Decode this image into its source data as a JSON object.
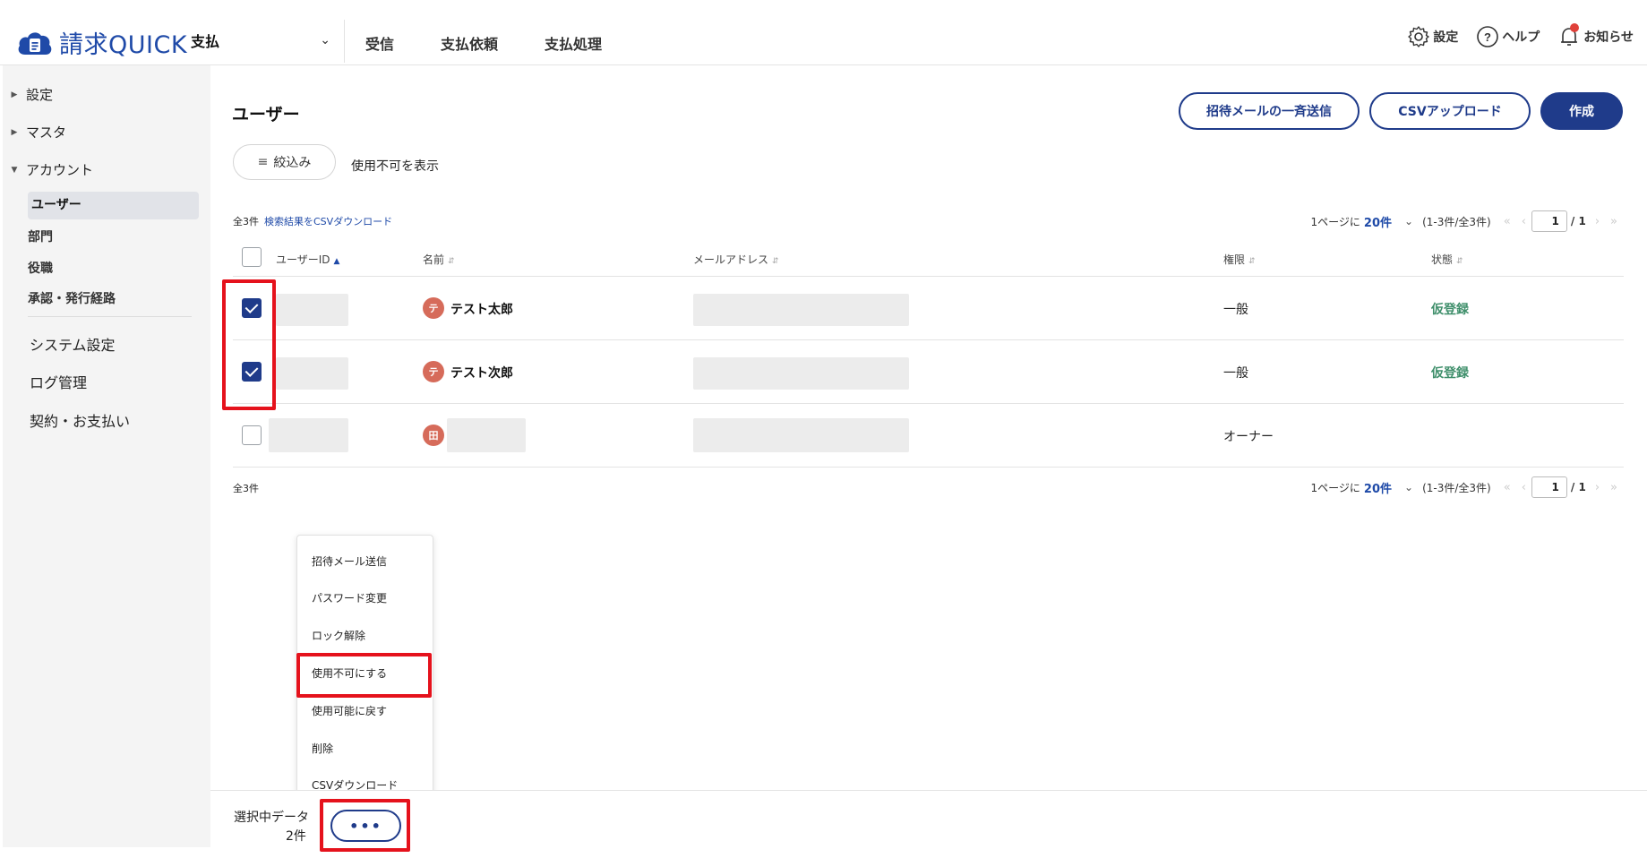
{
  "app": {
    "logo_text": "請求QUICK",
    "context": "支払",
    "nav": [
      "受信",
      "支払依頼",
      "支払処理"
    ],
    "header_right": {
      "settings": "設定",
      "help": "ヘルプ",
      "notifications": "お知らせ"
    }
  },
  "sidebar": {
    "groups": [
      {
        "label": "設定",
        "expanded": false
      },
      {
        "label": "マスタ",
        "expanded": false
      },
      {
        "label": "アカウント",
        "expanded": true
      }
    ],
    "account_items": [
      "ユーザー",
      "部門",
      "役職",
      "承認・発行経路"
    ],
    "active_item": "ユーザー",
    "items": [
      "システム設定",
      "ログ管理",
      "契約・お支払い"
    ]
  },
  "page": {
    "title": "ユーザー",
    "actions": {
      "bulk_invite": "招待メールの一斉送信",
      "csv_upload": "CSVアップロード",
      "create": "作成"
    },
    "filter_label": "絞込み",
    "show_disabled": "使用不可を表示",
    "count_text": "全3件",
    "csv_download_link": "検索結果をCSVダウンロード",
    "pager": {
      "per_page_prefix": "1ページに",
      "per_page_value": "20件",
      "range": "(1-3件/全3件)",
      "current_page": "1",
      "total_pages": "/ 1"
    },
    "footer_count": "全3件"
  },
  "table": {
    "columns": [
      "ユーザーID",
      "名前",
      "メールアドレス",
      "権限",
      "状態"
    ],
    "rows": [
      {
        "checked": true,
        "avatar": "テ",
        "name": "テスト太郎",
        "role": "一般",
        "status": "仮登録"
      },
      {
        "checked": true,
        "avatar": "テ",
        "name": "テスト次郎",
        "role": "一般",
        "status": "仮登録"
      },
      {
        "checked": false,
        "avatar": "田",
        "name": "",
        "role": "オーナー",
        "status": ""
      }
    ]
  },
  "menu": {
    "items": [
      "招待メール送信",
      "パスワード変更",
      "ロック解除",
      "使用不可にする",
      "使用可能に戻す",
      "削除",
      "CSVダウンロード"
    ],
    "highlighted": "使用不可にする"
  },
  "selection_bar": {
    "label": "選択中データ",
    "count": "2件",
    "more_label": "•••"
  },
  "colors": {
    "brand": "#1f3b8a",
    "link": "#1f4aa8",
    "status_green": "#3f8f6b",
    "highlight_red": "#e5121c",
    "avatar": "#d66b5a"
  }
}
